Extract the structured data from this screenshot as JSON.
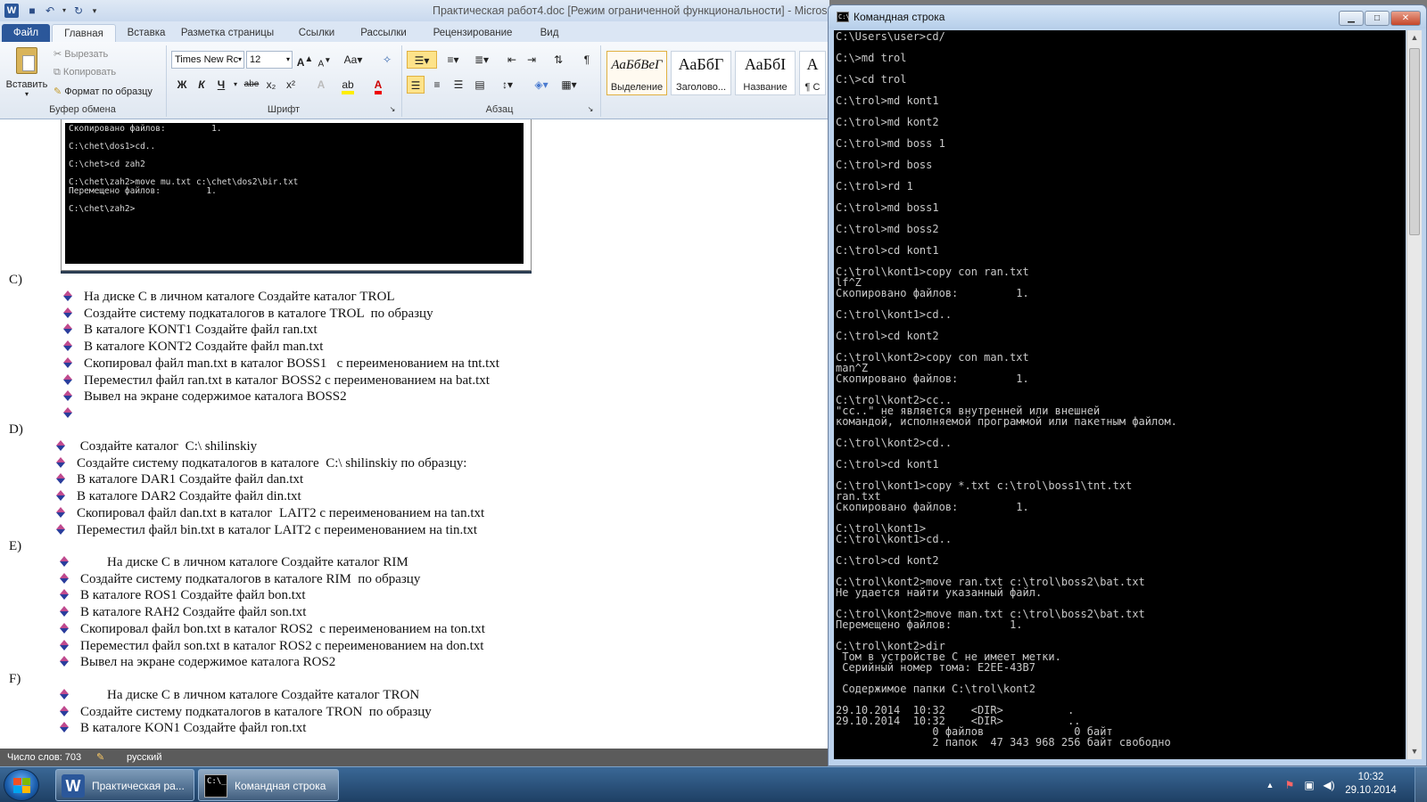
{
  "word": {
    "window_title": "Практическая работ4.doc [Режим ограниченной функциональности]  -  Microsoft",
    "tabs": [
      "Файл",
      "Главная",
      "Вставка",
      "Разметка страницы",
      "Ссылки",
      "Рассылки",
      "Рецензирование",
      "Вид"
    ],
    "ribbon": {
      "clipboard": {
        "paste": "Вставить",
        "cut": "Вырезать",
        "copy": "Копировать",
        "format_painter": "Формат по образцу",
        "label": "Буфер обмена"
      },
      "font": {
        "font_name": "Times New Rc",
        "font_size": "12",
        "label": "Шрифт",
        "bold": "Ж",
        "italic": "К",
        "underline": "Ч",
        "strike": "abe",
        "sub": "x₂",
        "sup": "x²",
        "grow": "A",
        "shrink": "A",
        "case": "Aa"
      },
      "paragraph": {
        "label": "Абзац"
      },
      "styles": [
        {
          "sample": "АаБбВеГ",
          "name": "Выделение"
        },
        {
          "sample": "АаБбГ",
          "name": "Заголово..."
        },
        {
          "sample": "АаБбІ",
          "name": "Название"
        },
        {
          "sample": "А",
          "name": "¶ С"
        }
      ]
    },
    "embedded_console": "Скопировано файлов:         1.\n\nC:\\chet\\dos1>cd..\n\nC:\\chet>cd zah2\n\nC:\\chet\\zah2>move mu.txt c:\\chet\\dos2\\bir.txt\nПеремещено файлов:         1.\n\nC:\\chet\\zah2>",
    "document": {
      "sections": [
        {
          "label": "C)",
          "items": [
            "На диске С в личном каталоге Создайте каталог TROL",
            "Создайте систему подкаталогов в каталоге TROL  по образцу",
            "В каталоге KONT1 Создайте файл ran.txt",
            "В каталоге KONT2 Создайте файл man.txt",
            "Скопировал файл man.txt в каталог BOSS1   с переименованием на tnt.txt",
            "Переместил файл ran.txt в каталог BOSS2 с переименованием на bat.txt",
            "Вывел на экране содержимое каталога BOSS2",
            ""
          ]
        },
        {
          "label": "D)",
          "items": [
            " Создайте каталог  С:\\ shilinskiy",
            "Создайте систему подкаталогов в каталоге  С:\\ shilinskiy по образцу:",
            "В каталоге DAR1 Создайте файл dan.txt",
            "В каталоге DAR2 Создайте файл din.txt",
            "Скопировал файл dan.txt в каталог  LAIT2 с переименованием на tan.txt",
            "Переместил файл bin.txt в каталог LAIT2 с переименованием на tin.txt"
          ]
        },
        {
          "label": "E)",
          "items": [
            "        На диске С в личном каталоге Создайте каталог RIM",
            "Создайте систему подкаталогов в каталоге RIM  по образцу",
            "В каталоге ROS1 Создайте файл bon.txt",
            "В каталоге RAH2 Создайте файл son.txt",
            "Скопировал файл bon.txt в каталог ROS2  с переименованием на ton.txt",
            "Переместил файл son.txt в каталог ROS2 с переименованием на don.txt",
            "Вывел на экране содержимое каталога ROS2"
          ]
        },
        {
          "label": "F)",
          "items": [
            "        На диске С в личном каталоге Создайте каталог TRON",
            "Создайте систему подкаталогов в каталоге TRON  по образцу",
            "В каталоге KON1 Создайте файл ron.txt"
          ]
        }
      ]
    },
    "status": {
      "word_count": "Число слов: 703",
      "language": "русский"
    }
  },
  "cmd": {
    "window_title": "Командная строка",
    "output": "C:\\Users\\user>cd/\n\nC:\\>md trol\n\nC:\\>cd trol\n\nC:\\trol>md kont1\n\nC:\\trol>md kont2\n\nC:\\trol>md boss 1\n\nC:\\trol>rd boss\n\nC:\\trol>rd 1\n\nC:\\trol>md boss1\n\nC:\\trol>md boss2\n\nC:\\trol>cd kont1\n\nC:\\trol\\kont1>copy con ran.txt\nlf^Z\nСкопировано файлов:         1.\n\nC:\\trol\\kont1>cd..\n\nC:\\trol>cd kont2\n\nC:\\trol\\kont2>copy con man.txt\nman^Z\nСкопировано файлов:         1.\n\nC:\\trol\\kont2>cc..\n\"cc..\" не является внутренней или внешней\nкомандой, исполняемой программой или пакетным файлом.\n\nC:\\trol\\kont2>cd..\n\nC:\\trol>cd kont1\n\nC:\\trol\\kont1>copy *.txt c:\\trol\\boss1\\tnt.txt\nran.txt\nСкопировано файлов:         1.\n\nC:\\trol\\kont1>\nC:\\trol\\kont1>cd..\n\nC:\\trol>cd kont2\n\nC:\\trol\\kont2>move ran.txt c:\\trol\\boss2\\bat.txt\nНе удается найти указанный файл.\n\nC:\\trol\\kont2>move man.txt c:\\trol\\boss2\\bat.txt\nПеремещено файлов:         1.\n\nC:\\trol\\kont2>dir\n Том в устройстве C не имеет метки.\n Серийный номер тома: E2EE-43B7\n\n Содержимое папки C:\\trol\\kont2\n\n29.10.2014  10:32    <DIR>          .\n29.10.2014  10:32    <DIR>          ..\n               0 файлов              0 байт\n               2 папок  47 343 968 256 байт свободно"
  },
  "taskbar": {
    "tasks": [
      {
        "label": "Практическая ра..."
      },
      {
        "label": "Командная строка"
      }
    ],
    "clock_time": "10:32",
    "clock_date": "29.10.2014"
  },
  "colors": {
    "word_accent": "#2b579a",
    "cmd_bg": "#000000",
    "taskbar": "#2a5580"
  }
}
